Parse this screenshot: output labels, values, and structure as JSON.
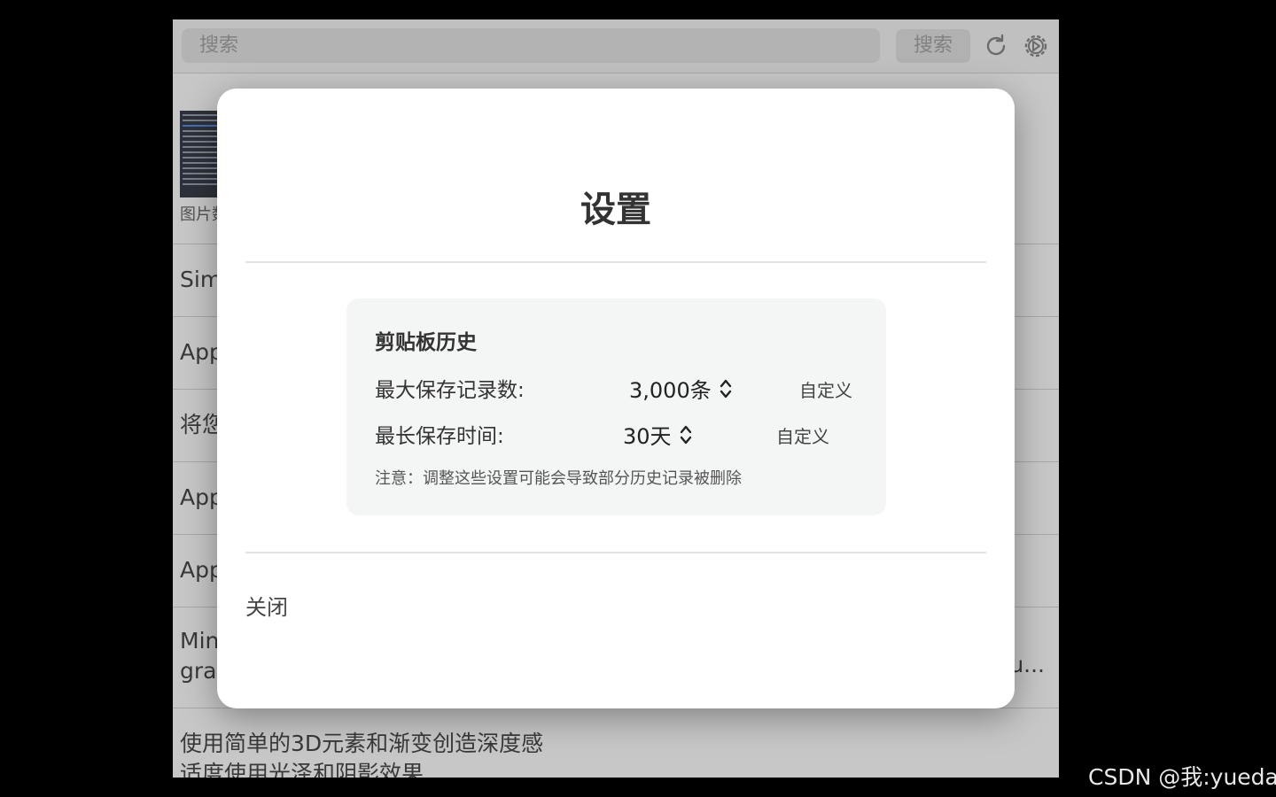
{
  "app": {
    "search": {
      "placeholder": "搜索"
    },
    "search_button_label": "搜索",
    "icons": {
      "refresh": "refresh-icon",
      "settings": "gear-icon"
    },
    "history_rows": [
      {
        "kind": "image",
        "caption": "图片数"
      },
      {
        "kind": "text",
        "text": "Sim"
      },
      {
        "kind": "text",
        "text": "App"
      },
      {
        "kind": "text",
        "text": "将您"
      },
      {
        "kind": "text",
        "text": "App"
      },
      {
        "kind": "text",
        "text": "App"
      },
      {
        "kind": "text",
        "text_line1": "Min",
        "text_line2": "grad",
        "tail": "u..."
      },
      {
        "kind": "text",
        "text_line1": "使用简单的3D元素和渐变创造深度感",
        "text_line2": "适度使用光泽和阴影效果"
      }
    ]
  },
  "modal": {
    "title": "设置",
    "section": {
      "title": "剪贴板历史",
      "max_records": {
        "label": "最大保存记录数:",
        "value": "3,000条",
        "custom_label": "自定义"
      },
      "max_duration": {
        "label": "最长保存时间:",
        "value": "30天",
        "custom_label": "自定义"
      },
      "note": "注意：调整这些设置可能会导致部分历史记录被删除"
    },
    "close_label": "关闭"
  },
  "watermark": "CSDN @我:yueda",
  "colors": {
    "page_background": "#000000",
    "modal_background": "#ffffff",
    "section_background": "#f4f5f5",
    "text_primary": "#333333",
    "overlay": "rgba(0,0,0,0.22)"
  }
}
